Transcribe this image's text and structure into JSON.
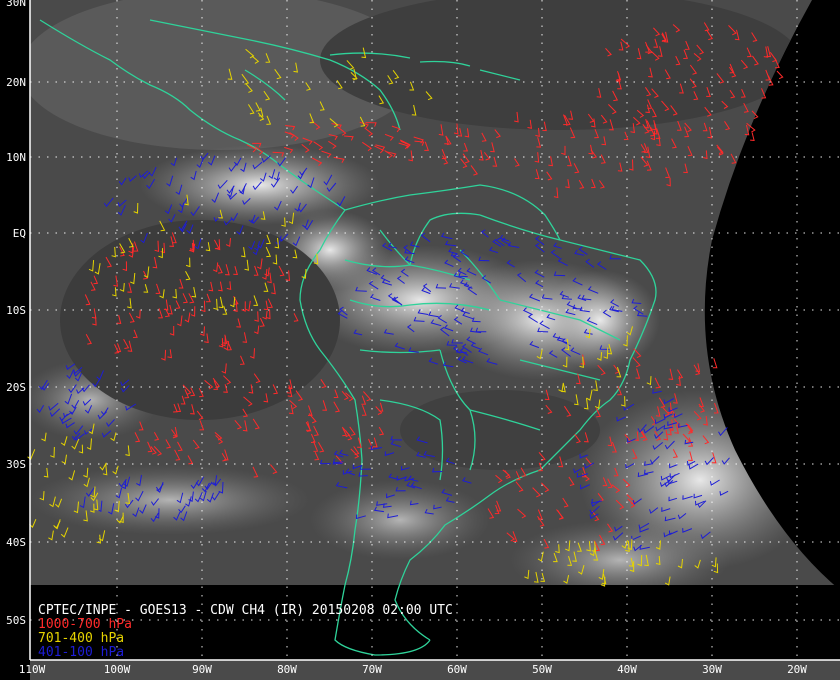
{
  "title": "CPTEC/INPE - GOES13 - CDW CH4 (IR) 20150208 02:00 UTC",
  "colors": {
    "background": "#000000",
    "coastline": "#2fd39a",
    "grid": "#ffffff",
    "low_level": "#ff2a2a",
    "mid_level": "#e6d400",
    "high_level": "#1d1dd6"
  },
  "legend": [
    {
      "label": "1000-700 hPa",
      "color": "#ff2a2a"
    },
    {
      "label": "701-400 hPa",
      "color": "#e6d400"
    },
    {
      "label": "401-100 hPa",
      "color": "#1d1dd6"
    }
  ],
  "latitude_labels": [
    "30N",
    "20N",
    "10N",
    "EQ",
    "10S",
    "20S",
    "30S",
    "40S",
    "50S"
  ],
  "longitude_labels": [
    "110W",
    "100W",
    "90W",
    "80W",
    "70W",
    "60W",
    "50W",
    "40W",
    "30W",
    "20W"
  ]
}
